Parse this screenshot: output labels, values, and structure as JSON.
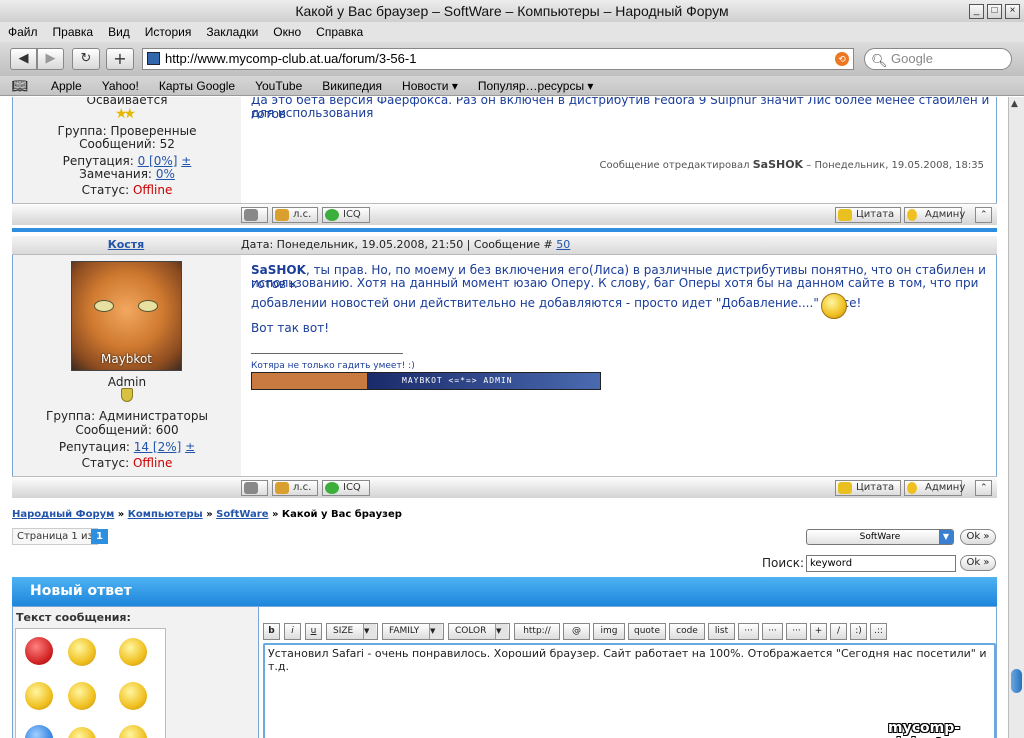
{
  "window": {
    "title": "Какой у Вас браузер – SoftWare – Компьютеры – Народный Форум",
    "controls": [
      "_",
      "□",
      "×"
    ]
  },
  "menu": [
    "Файл",
    "Правка",
    "Вид",
    "История",
    "Закладки",
    "Окно",
    "Справка"
  ],
  "toolbar": {
    "back": "◀",
    "forward": "▶",
    "reload": "↻",
    "add": "+",
    "url": "http://www.mycomp-club.at.ua/forum/3-56-1",
    "search_placeholder": "Google"
  },
  "bookmarks": [
    "Apple",
    "Yahoo!",
    "Карты Google",
    "YouTube",
    "Википедия",
    "Новости ▾",
    "Популяр…ресурсы ▾"
  ],
  "post1": {
    "status": "Осваивается",
    "group": "Группа: Проверенные",
    "messages": "Сообщений: 52",
    "reputation_label": "Репутация:",
    "reputation_value": "0 [0%]",
    "plusminus": "±",
    "warnings_label": "Замечания:",
    "warnings_value": "0%",
    "status_label": "Статус:",
    "status_value": "Offline",
    "text_line1": "Да это бета версия Фаерфокса. Раз он включен в дистрибутив Fedora 9 Sulphur значит Лис более менее стабилен и готов",
    "text_line2": "для использования",
    "edited_prefix": "Сообщение отредактировал",
    "edited_by": "SaSHOK",
    "edited_date": "– Понедельник, 19.05.2008, 18:35"
  },
  "post2": {
    "author": "Костя",
    "date_label": "Дата: Понедельник, 19.05.2008, 21:50 | Сообщение #",
    "post_number": "50",
    "avatar_caption": "Maybkot",
    "rank": "Admin",
    "group": "Группа: Администраторы",
    "messages": "Сообщений: 600",
    "reputation_label": "Репутация:",
    "reputation_value": "14 [2%]",
    "plusminus": "±",
    "status_label": "Статус:",
    "status_value": "Offline",
    "addressee": "SaSHOK",
    "text_p1_a": ", ты прав. Но, по моему и без включения его(Лиса) в различные дистрибутивы понятно, что он стабилен и готов к",
    "text_p1_b": "использованию. Хотя на данный момент юзаю Оперу. К слову, баг Оперы хотя бы на данном сайте в том, что при",
    "text_p1_c": "добавлении новостей они действительно не добавляются - просто идет \"Добавление....\" И все!",
    "text_p2": "Вот так вот!",
    "signature_text": "Котяра не только гадить умеет! :)",
    "signature_banner": "MAYBKOT <=*=> ADMIN"
  },
  "post_buttons": {
    "pm": "л.с.",
    "icq": "ICQ",
    "quote": "Цитата",
    "admin": "Админу"
  },
  "breadcrumb": {
    "items": [
      "Народный Форум",
      "Компьютеры",
      "SoftWare"
    ],
    "separator": "»",
    "current": "Какой у Вас браузер"
  },
  "pager": {
    "label": "Страница 1 из",
    "current": "1"
  },
  "forum_jump": {
    "selected": "SoftWare",
    "ok": "Ok »"
  },
  "search": {
    "label": "Поиск:",
    "value": "keyword",
    "ok": "Ok »"
  },
  "reply": {
    "title": "Новый ответ",
    "message_label": "Текст сообщения:",
    "text": "Установил Safari - очень понравилось. Хороший браузер. Сайт работает на 100%. Отображается \"Сегодня нас посетили\" и т.д."
  },
  "editor_buttons": {
    "bold": "b",
    "italic": "i",
    "underline": "u",
    "size": "SIZE",
    "family": "FAMILY",
    "color": "COLOR",
    "http": "http://",
    "at": "@",
    "img": "img",
    "quote": "quote",
    "code": "code",
    "list": "list",
    "dots1": "···",
    "dots2": "···",
    "dots3": "···",
    "plus": "+",
    "slash": "/",
    "smile": ":)",
    "more": ".::"
  },
  "watermark": "mycomp-club.at.ua",
  "colors": {
    "accent_blue": "#2e8fe0",
    "link": "#2255aa",
    "offline": "#cc0000",
    "post_text": "#1a3d9a"
  },
  "icons": {
    "star": "star-icon",
    "shield": "shield-icon"
  }
}
